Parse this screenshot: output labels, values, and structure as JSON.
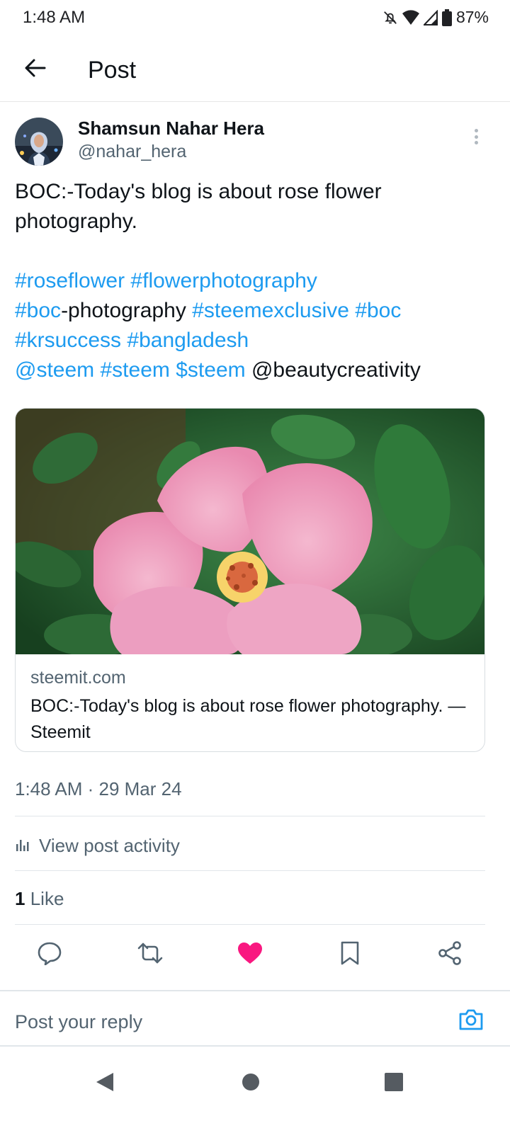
{
  "status_bar": {
    "time": "1:48 AM",
    "battery": "87%",
    "icons": [
      "bell-off-icon",
      "wifi-icon",
      "signal-icon",
      "battery-icon"
    ]
  },
  "header": {
    "title": "Post",
    "back_icon": "arrow-left-icon"
  },
  "post": {
    "author_name": "Shamsun Nahar Hera",
    "author_handle": "@nahar_hera",
    "text_intro": "BOC:-Today's blog is about rose flower photography.",
    "tokens": {
      "t1": "#roseflower",
      "t2": "#flowerphotography",
      "t3": "#boc",
      "t4": "-photography",
      "t5": "#steemexclusive",
      "t6": "#boc",
      "t7": "#krsuccess",
      "t8": "#bangladesh",
      "t9": "@steem",
      "t10": "#steem",
      "t11": "$steem",
      "t12": "@beautycreativity"
    },
    "link_card": {
      "domain": "steemit.com",
      "title": "BOC:-Today's blog is about rose flower photography. — Steemit"
    },
    "timestamp": "1:48 AM · 29 Mar 24",
    "activity_label": "View post activity",
    "likes_count": "1",
    "likes_label": "Like"
  },
  "actions": [
    "reply-icon",
    "repost-icon",
    "like-icon",
    "bookmark-icon",
    "share-icon"
  ],
  "reply": {
    "placeholder": "Post your reply"
  },
  "colors": {
    "link": "#1d9bf0",
    "like_active": "#f91880",
    "secondary_text": "#536471"
  }
}
